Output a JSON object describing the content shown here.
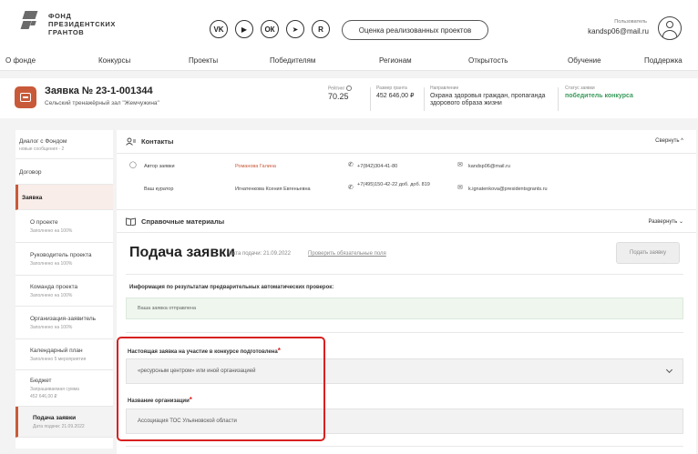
{
  "header": {
    "logo_text": [
      "ФОНД",
      "ПРЕЗИДЕНТСКИХ",
      "ГРАНТОВ"
    ],
    "social": [
      {
        "icon": "vk-icon",
        "glyph": "VK"
      },
      {
        "icon": "youtube-icon",
        "glyph": "▶"
      },
      {
        "icon": "odnoklassniki-icon",
        "glyph": "ОК"
      },
      {
        "icon": "telegram-icon",
        "glyph": "➤"
      },
      {
        "icon": "rutube-icon",
        "glyph": "R"
      }
    ],
    "eval_button": "Оценка реализованных проектов",
    "user_role": "Пользователь",
    "user_email": "kandsp06@mail.ru"
  },
  "nav": [
    "О фонде",
    "Конкурсы",
    "Проекты",
    "Победителям",
    "Регионам",
    "Открытость",
    "Обучение",
    "Поддержка"
  ],
  "application": {
    "title": "Заявка № 23-1-001344",
    "subtitle": "Сельский тренажёрный зал \"Жемчужина\"",
    "rating_label": "Рейтинг",
    "rating_value": "70.25",
    "grant_label": "Размер гранта",
    "grant_value": "452 646,00 ₽",
    "direction_label": "Направление",
    "direction_value": "Охрана здоровья граждан, пропаганда здорового образа жизни",
    "status_label": "Статус заявки",
    "status_value": "победитель конкурса"
  },
  "sidebar": {
    "items": [
      {
        "title": "Диалог с Фондом",
        "sub": "новые сообщения - 2"
      },
      {
        "title": "Договор",
        "sub": ""
      },
      {
        "title": "Заявка",
        "sub": ""
      },
      {
        "title": "О проекте",
        "sub": "Заполнено на 100%"
      },
      {
        "title": "Руководитель проекта",
        "sub": "Заполнено на 100%"
      },
      {
        "title": "Команда проекта",
        "sub": "Заполнено на 100%"
      },
      {
        "title": "Организация-заявитель",
        "sub": "Заполнено на 100%"
      },
      {
        "title": "Календарный план",
        "sub": "Заполнено 5 мероприятия"
      },
      {
        "title": "Бюджет",
        "sub": "Запрашиваемая сумма",
        "sub2": "452 646,00 ₽"
      },
      {
        "title": "Подача заявки",
        "sub": "Дата подачи: 21.09.2022"
      }
    ]
  },
  "contacts": {
    "label": "Контакты",
    "action": "Свернуть",
    "author_label": "Автор заявки",
    "author_name": "Романова Галина",
    "author_phone": "+7(842)304-41-80",
    "author_email": "kandsp06@mail.ru",
    "curator_label": "Ваш куратор",
    "curator_name": "Игнатенкова Ксения Евгеньевна",
    "curator_phone": "+7(495)150-42-22 доб. доб. 819",
    "curator_email": "k.ignatenkova@presidentsgrants.ru"
  },
  "reference": {
    "label": "Справочные материалы",
    "action": "Развернуть"
  },
  "submission": {
    "title": "Подача заявки",
    "date": "Дата подачи: 21.09.2022",
    "check_link": "Проверить обязательные поля",
    "submit_button": "Подать заявку",
    "checks_title": "Информация по результатам предварительных автоматических проверок:",
    "checks_result": "Ваша заявка отправлена",
    "participation_label": "Настоящая заявка на участие в конкурсе подготовлена",
    "participation_value": "«ресурсным центром» или иной организацией",
    "org_label": "Название организации",
    "org_value": "Ассоциация ТОС Ульяновской области"
  }
}
